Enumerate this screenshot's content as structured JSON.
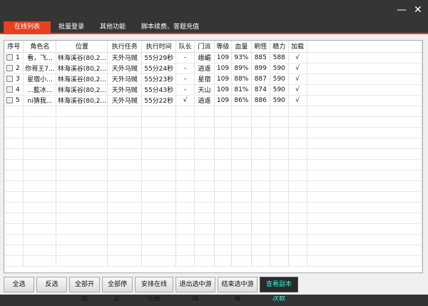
{
  "window": {
    "minimize": "—",
    "close": "✕"
  },
  "tabs": [
    "在线列表",
    "批量登录",
    "其他功能",
    "脚本续费、答题充值"
  ],
  "table": {
    "headers": [
      "序号",
      "角色名",
      "位置",
      "执行任务",
      "执行时间",
      "队长",
      "门派",
      "等级",
      "血量",
      "刷怪",
      "精力",
      "加载"
    ],
    "rows": [
      [
        "1",
        "看，飞...",
        "林海溪谷(80,2...",
        "天外马贼",
        "55分29秒",
        "-",
        "峨嵋",
        "109",
        "93%",
        "885",
        "588",
        "√"
      ],
      [
        "2",
        "你哥王7...",
        "林海溪谷(80,2...",
        "天外马贼",
        "55分24秒",
        "-",
        "逍遥",
        "109",
        "89%",
        "899",
        "590",
        "√"
      ],
      [
        "3",
        "星宿小...",
        "林海溪谷(80,2...",
        "天外马贼",
        "55分23秒",
        "-",
        "星宿",
        "109",
        "88%",
        "887",
        "590",
        "√"
      ],
      [
        "4",
        "...藍冰...",
        "林海溪谷(80,2...",
        "天外马贼",
        "55分43秒",
        "-",
        "天山",
        "109",
        "81%",
        "874",
        "590",
        "√"
      ],
      [
        "5",
        "ni猜我...",
        "林海溪谷(80,2...",
        "天外马贼",
        "55分22秒",
        "√",
        "逍遥",
        "109",
        "86%",
        "886",
        "590",
        "√"
      ]
    ]
  },
  "buttons": [
    "全选",
    "反选",
    "全部开始",
    "全部停止",
    "安排在线任务",
    "退出选中游戏",
    "结束选中游戏",
    "查看副本次数"
  ]
}
